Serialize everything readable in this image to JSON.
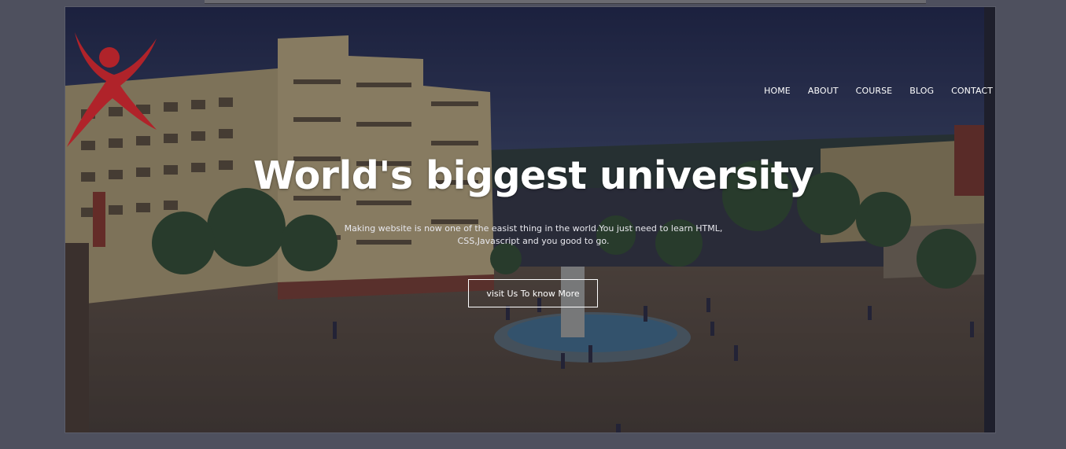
{
  "nav": {
    "items": [
      "HOME",
      "ABOUT",
      "COURSE",
      "BLOG",
      "CONTACT"
    ]
  },
  "hero": {
    "headline": "World's biggest university",
    "subtext": "Making website is now one of the easist thing in the world.You just need to learn HTML, CSS,Javascript and you good to go.",
    "cta_label": "visit Us To know More"
  },
  "colors": {
    "logo": "#b0232a",
    "page_background": "#4e505e",
    "text": "#ffffff"
  },
  "icons": {
    "logo": "person-jumping-logo-icon"
  }
}
